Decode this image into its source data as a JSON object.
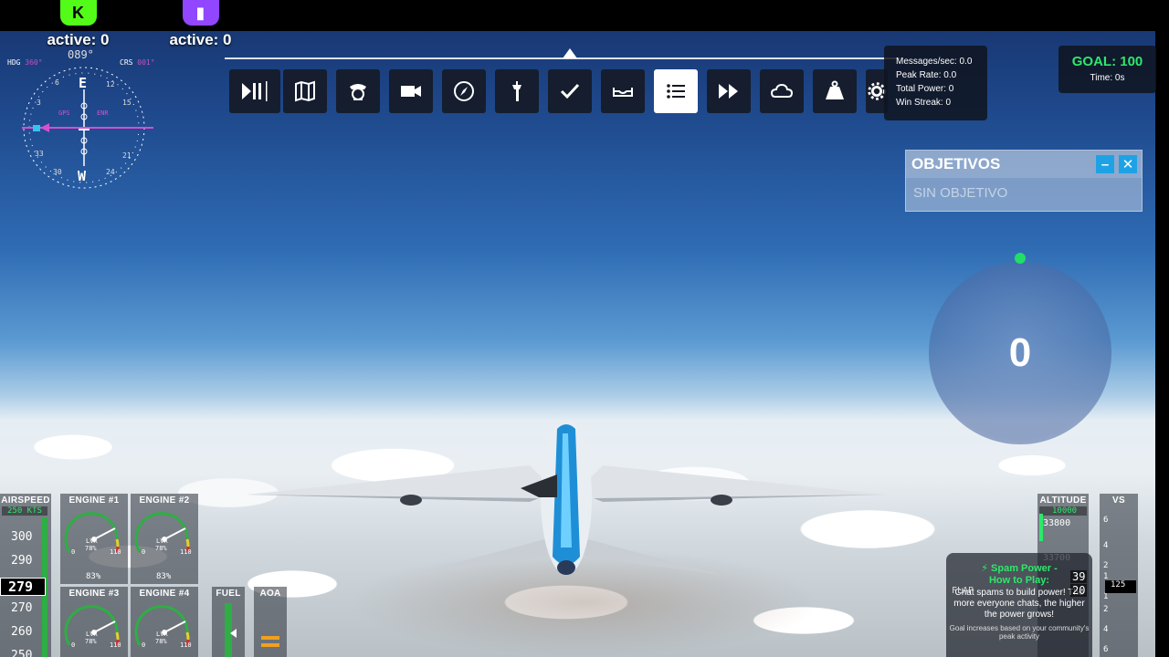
{
  "streams": [
    {
      "platform": "kick",
      "label": "active: 0",
      "color": "#53fc18"
    },
    {
      "platform": "twitch",
      "label": "active: 0",
      "color": "#9146ff"
    }
  ],
  "compass": {
    "heading_display": "089°",
    "hdg_label": "HDG",
    "hdg_value": "360°",
    "crs_label": "CRS",
    "crs_value": "001°",
    "gps_label": "GPS",
    "enr_label": "ENR",
    "cardinal_e": "E",
    "cardinal_w": "W",
    "ticks": [
      "6",
      "12",
      "15",
      "21",
      "24",
      "30",
      "33",
      "3"
    ]
  },
  "toolbar": {
    "items": [
      {
        "name": "play-pause",
        "active": false
      },
      {
        "name": "map",
        "active": false
      },
      {
        "name": "pilot",
        "active": false
      },
      {
        "name": "camera",
        "active": false
      },
      {
        "name": "navlog",
        "active": false
      },
      {
        "name": "atc-tower",
        "active": false
      },
      {
        "name": "checklist",
        "active": false
      },
      {
        "name": "controls",
        "active": false
      },
      {
        "name": "objectives-list",
        "active": true
      },
      {
        "name": "fast-forward",
        "active": false
      },
      {
        "name": "weather",
        "active": false
      },
      {
        "name": "weight",
        "active": false
      },
      {
        "name": "settings",
        "active": false
      }
    ]
  },
  "stats": {
    "messages": "Messages/sec: 0.0",
    "peak": "Peak Rate: 0.0",
    "power": "Total Power: 0",
    "streak": "Win Streak: 0"
  },
  "goal": {
    "label": "GOAL: 100",
    "time": "Time: 0s"
  },
  "objectives": {
    "title": "OBJETIVOS",
    "empty": "SIN OBJETIVO",
    "minimize": "–",
    "close": "✕"
  },
  "power_orb": {
    "value": "0"
  },
  "airspeed": {
    "title": "AIRSPEED",
    "set": "250 KTS",
    "ticks": [
      "300",
      "290",
      "270",
      "260",
      "250"
    ],
    "current": "279"
  },
  "engines": [
    {
      "title": "ENGINE #1",
      "lvr": "LVR",
      "pct_inner": "78%",
      "pct": "83%",
      "min": "0",
      "max": "110"
    },
    {
      "title": "ENGINE #2",
      "lvr": "LVR",
      "pct_inner": "78%",
      "pct": "83%",
      "min": "0",
      "max": "110"
    },
    {
      "title": "ENGINE #3",
      "lvr": "LVR",
      "pct_inner": "78%",
      "min": "0",
      "max": "110"
    },
    {
      "title": "ENGINE #4",
      "lvr": "LVR",
      "pct_inner": "78%",
      "min": "0",
      "max": "110"
    }
  ],
  "fuel": {
    "title": "FUEL"
  },
  "aoa": {
    "title": "AOA"
  },
  "altitude": {
    "title": "ALTITUDE",
    "set": "10000",
    "top": "33800",
    "mid": "33700",
    "current_a": "39",
    "current_b": "20",
    "flaps": "FLAP"
  },
  "vs": {
    "title": "VS",
    "ticks": [
      "6",
      "4",
      "2",
      "1",
      "1",
      "2",
      "4",
      "6"
    ],
    "value": "125"
  },
  "spam": {
    "title1": "⚡ Spam Power -",
    "title2": "How to Play:",
    "body": "Chat spams to build power! The more everyone chats, the higher the power grows!",
    "footer": "Goal increases based on your community's peak activity"
  },
  "colors": {
    "accent_green": "#2ee86b",
    "accent_blue": "#1ea2e6",
    "toolbar_bg": "#14182a"
  }
}
